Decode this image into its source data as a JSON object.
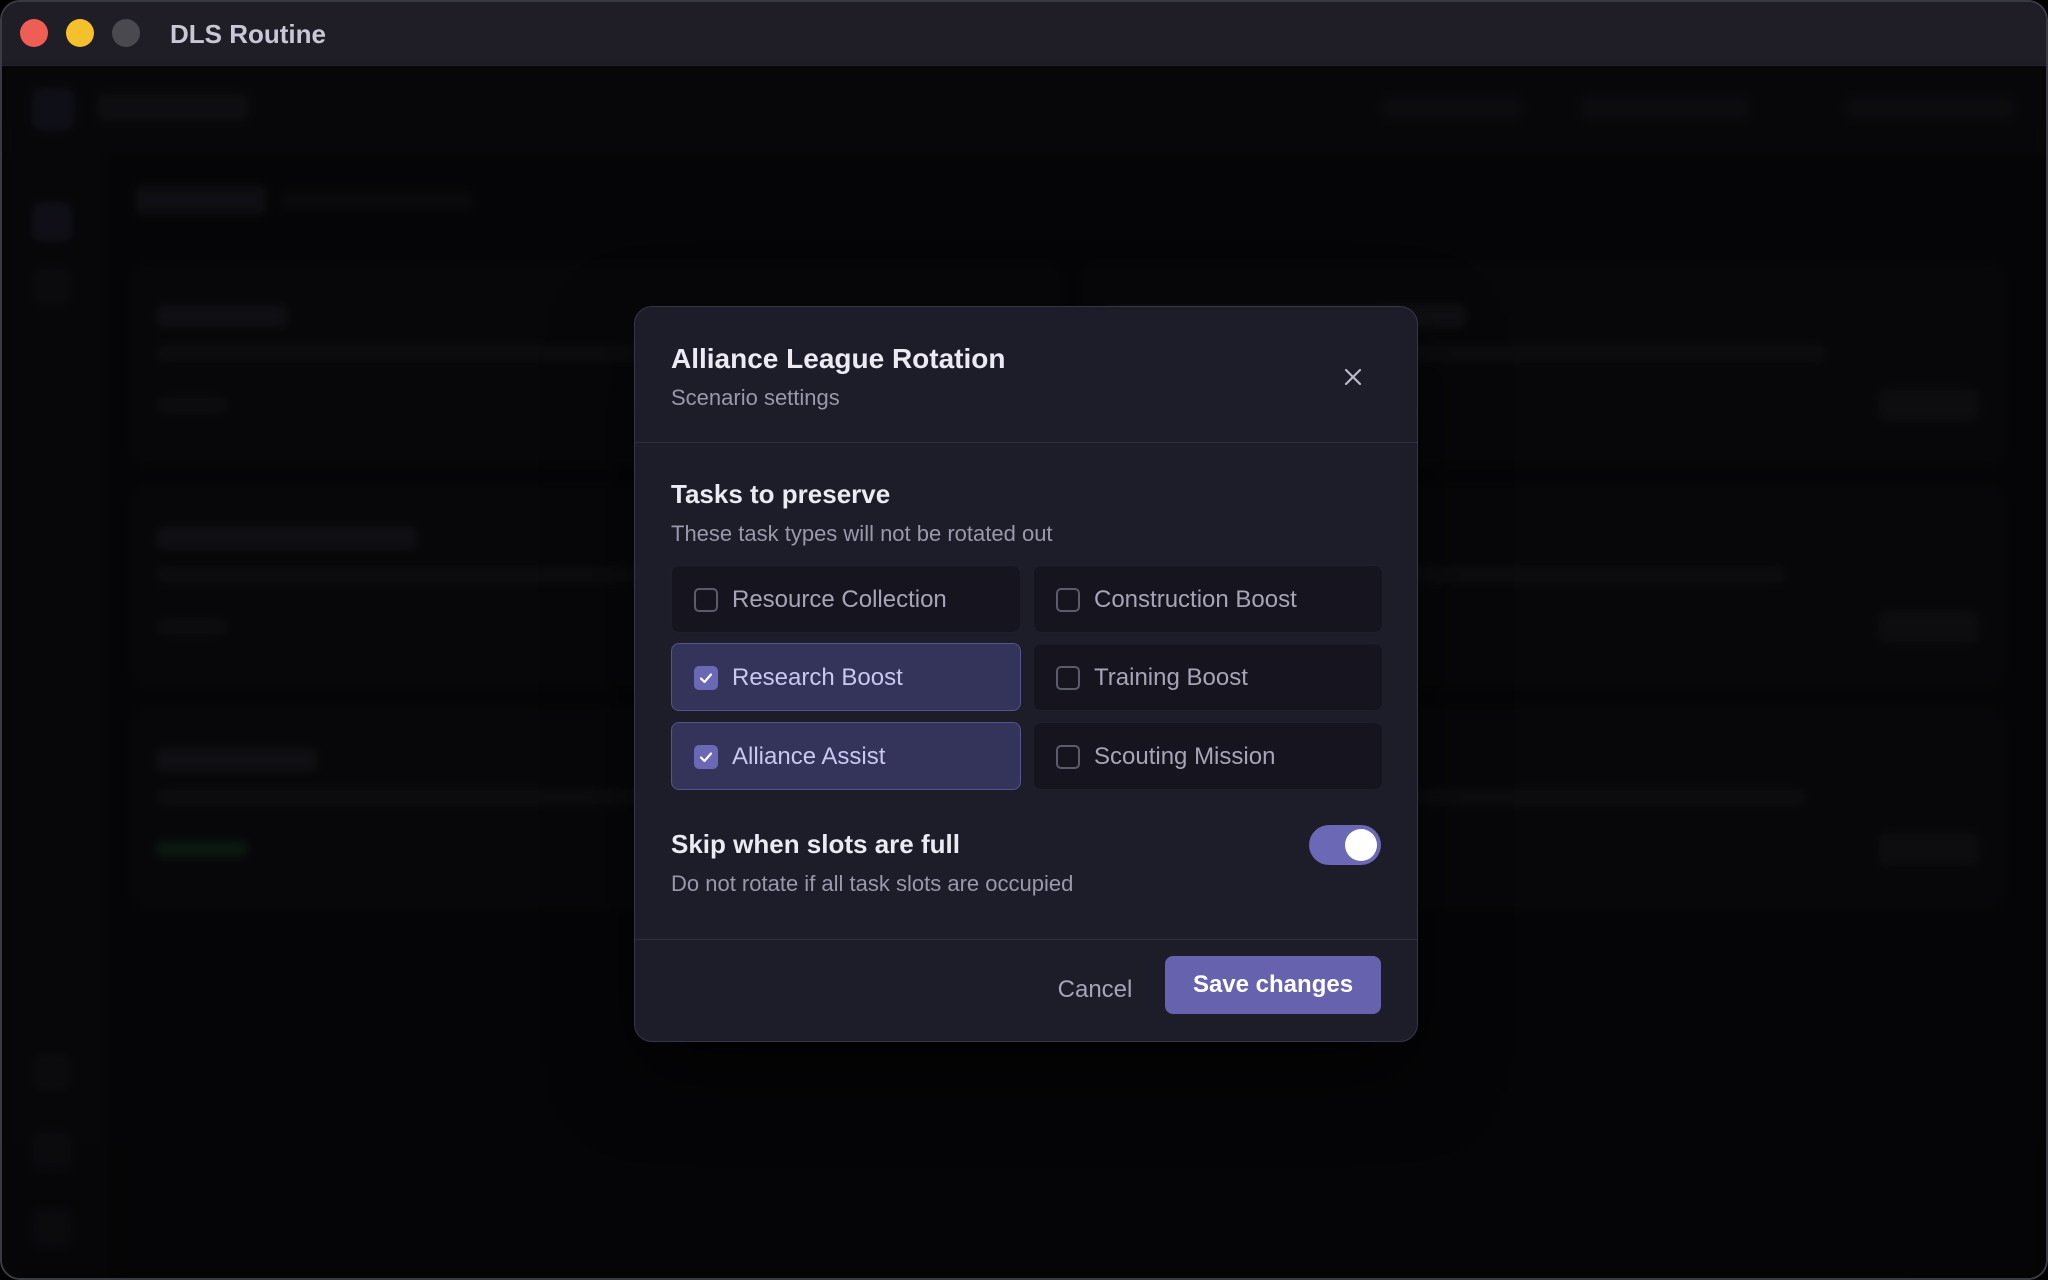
{
  "window": {
    "title": "DLS Routine"
  },
  "dialog": {
    "title": "Alliance League Rotation",
    "subtitle": "Scenario settings",
    "section": {
      "title": "Tasks to preserve",
      "description": "These task types will not be rotated out"
    },
    "options": [
      {
        "label": "Resource Collection",
        "checked": false
      },
      {
        "label": "Construction Boost",
        "checked": false
      },
      {
        "label": "Research Boost",
        "checked": true
      },
      {
        "label": "Training Boost",
        "checked": false
      },
      {
        "label": "Alliance Assist",
        "checked": true
      },
      {
        "label": "Scouting Mission",
        "checked": false
      }
    ],
    "skip": {
      "title": "Skip when slots are full",
      "description": "Do not rotate if all task slots are occupied",
      "enabled": true
    },
    "footer": {
      "cancel_label": "Cancel",
      "save_label": "Save changes"
    }
  },
  "colors": {
    "accent": "#6662ad",
    "dialog_bg": "#1d1c29",
    "checked_bg": "#34335a"
  }
}
